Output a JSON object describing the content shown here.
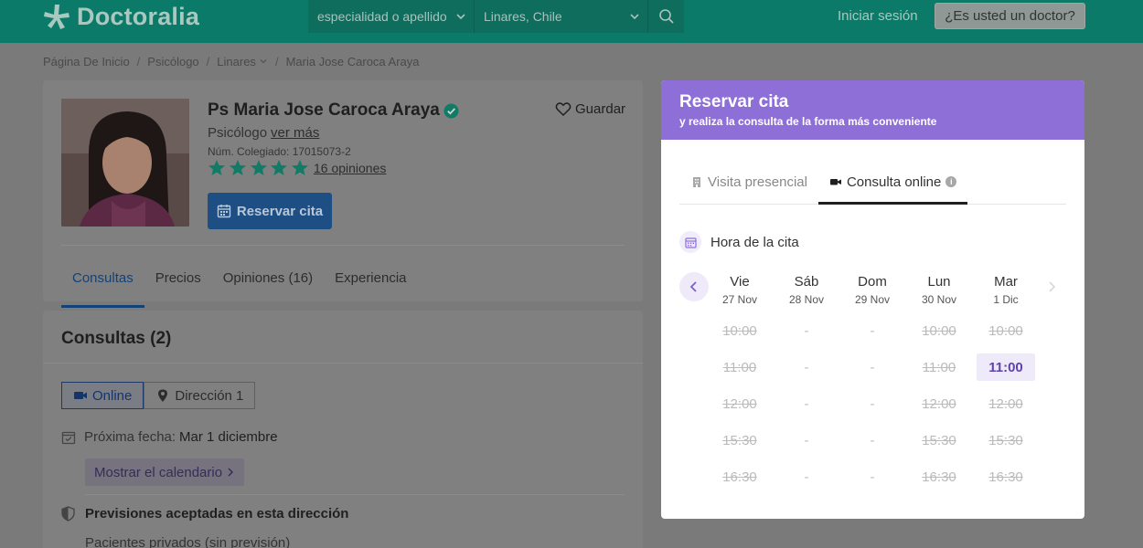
{
  "header": {
    "logo_text": "Doctoralia",
    "search_placeholder": "especialidad o apellido",
    "location_value": "Linares, Chile",
    "login_label": "Iniciar sesión",
    "doctor_button_label": "¿Es usted un doctor?"
  },
  "breadcrumb": [
    "Página De Inicio",
    "Psicólogo",
    "Linares",
    "Maria Jose Caroca Araya"
  ],
  "profile": {
    "name": "Ps Maria Jose Caroca Araya",
    "save_label": "Guardar",
    "specialty": "Psicólogo",
    "see_more": "ver más",
    "registration": "Núm. Colegiado: 17015073-2",
    "rating_stars": 5,
    "reviews_label": "16 opiniones",
    "book_label": "Reservar cita",
    "tabs": [
      {
        "label": "Consultas",
        "active": true
      },
      {
        "label": "Precios",
        "active": false
      },
      {
        "label": "Opiniones (16)",
        "active": false
      },
      {
        "label": "Experiencia",
        "active": false
      }
    ]
  },
  "consultas": {
    "title": "Consultas (2)",
    "address_tabs": [
      {
        "label": "Online",
        "icon": "video-icon",
        "active": true
      },
      {
        "label": "Dirección 1",
        "icon": "location-pin-icon",
        "active": false
      }
    ],
    "next_date_label": "Próxima fecha:",
    "next_date_value": "Mar 1 diciembre",
    "show_calendar_label": "Mostrar el calendario",
    "previsiones_title": "Previsiones aceptadas en esta dirección",
    "previsiones_first": "Pacientes privados (sin previsión)"
  },
  "booking": {
    "title": "Reservar cita",
    "subtitle": "y realiza la consulta de la forma más conveniente",
    "visit_tabs": [
      {
        "label": "Visita presencial",
        "active": false
      },
      {
        "label": "Consulta online",
        "active": true
      }
    ],
    "hour_label": "Hora de la cita",
    "days": [
      {
        "name": "Vie",
        "date": "27 Nov",
        "slots": [
          {
            "label": "10:00",
            "state": "taken"
          },
          {
            "label": "11:00",
            "state": "taken"
          },
          {
            "label": "12:00",
            "state": "taken"
          },
          {
            "label": "15:30",
            "state": "taken"
          },
          {
            "label": "16:30",
            "state": "taken"
          }
        ]
      },
      {
        "name": "Sáb",
        "date": "28 Nov",
        "slots": [
          {
            "label": "-",
            "state": "none"
          },
          {
            "label": "-",
            "state": "none"
          },
          {
            "label": "-",
            "state": "none"
          },
          {
            "label": "-",
            "state": "none"
          },
          {
            "label": "-",
            "state": "none"
          }
        ]
      },
      {
        "name": "Dom",
        "date": "29 Nov",
        "slots": [
          {
            "label": "-",
            "state": "none"
          },
          {
            "label": "-",
            "state": "none"
          },
          {
            "label": "-",
            "state": "none"
          },
          {
            "label": "-",
            "state": "none"
          },
          {
            "label": "-",
            "state": "none"
          }
        ]
      },
      {
        "name": "Lun",
        "date": "30 Nov",
        "slots": [
          {
            "label": "10:00",
            "state": "taken"
          },
          {
            "label": "11:00",
            "state": "taken"
          },
          {
            "label": "12:00",
            "state": "taken"
          },
          {
            "label": "15:30",
            "state": "taken"
          },
          {
            "label": "16:30",
            "state": "taken"
          }
        ]
      },
      {
        "name": "Mar",
        "date": "1 Dic",
        "slots": [
          {
            "label": "10:00",
            "state": "taken"
          },
          {
            "label": "11:00",
            "state": "available"
          },
          {
            "label": "12:00",
            "state": "taken"
          },
          {
            "label": "15:30",
            "state": "taken"
          },
          {
            "label": "16:30",
            "state": "taken"
          }
        ]
      }
    ]
  },
  "colors": {
    "header_bg": "#0b7a68",
    "primary_blue": "#1e4f84",
    "booking_purple": "#8e6fd7",
    "available_slot_text": "#5e43ad",
    "star_green": "#137a66"
  }
}
